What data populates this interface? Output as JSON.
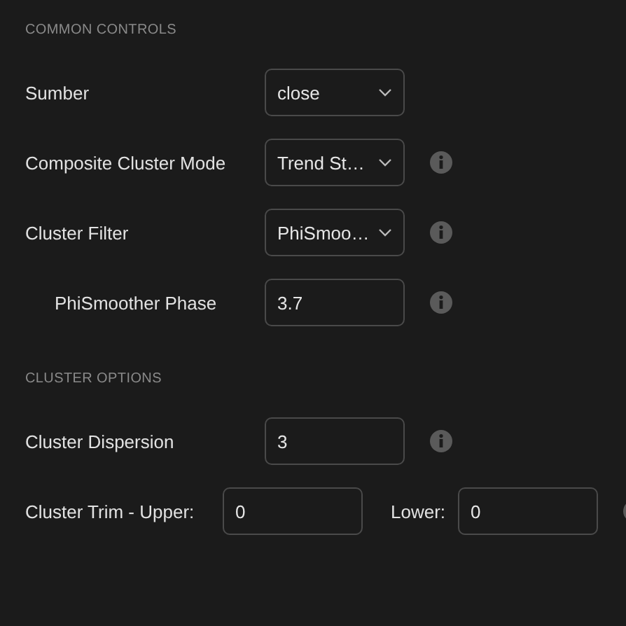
{
  "sections": [
    {
      "title": "COMMON CONTROLS",
      "rows": [
        {
          "kind": "select",
          "label": "Sumber",
          "value": "close",
          "info": false
        },
        {
          "kind": "select",
          "label": "Composite Cluster Mode",
          "value": "Trend St…",
          "info": true
        },
        {
          "kind": "select",
          "label": "Cluster Filter",
          "value": "PhiSmoo…",
          "info": true,
          "children": [
            {
              "kind": "input",
              "label": "PhiSmoother Phase",
              "value": "3.7",
              "info": true
            }
          ]
        }
      ]
    },
    {
      "title": "CLUSTER OPTIONS",
      "rows": [
        {
          "kind": "input",
          "label": "Cluster Dispersion",
          "value": "3",
          "info": true
        },
        {
          "kind": "pair",
          "label": "Cluster Trim - Upper:",
          "value": "0",
          "label_2": "Lower:",
          "value_2": "0",
          "info": true
        }
      ]
    }
  ]
}
